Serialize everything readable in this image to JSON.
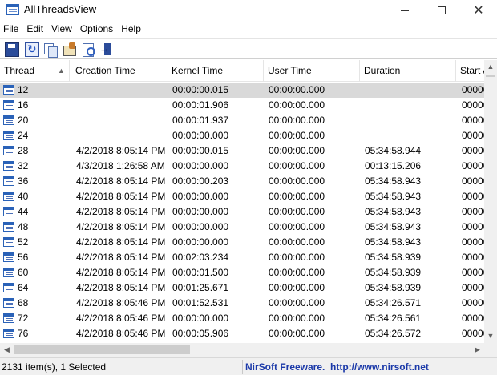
{
  "window": {
    "title": "AllThreadsView",
    "minimize_glyph": "",
    "maximize_glyph": "",
    "close_glyph": "✕"
  },
  "menu": [
    "File",
    "Edit",
    "View",
    "Options",
    "Help"
  ],
  "toolbar": {
    "buttons": [
      "save-icon",
      "refresh-icon",
      "copy-icon",
      "properties-icon",
      "find-icon",
      "exit-icon"
    ]
  },
  "table": {
    "columns": [
      "Thread",
      "Creation Time",
      "Kernel Time",
      "User Time",
      "Duration",
      "Start A"
    ],
    "sort_indicator": "▲",
    "rows": [
      {
        "thread": "12",
        "creation": "",
        "kernel": "00:00:00.015",
        "user": "00:00:00.000",
        "duration": "",
        "start": "00000",
        "selected": true
      },
      {
        "thread": "16",
        "creation": "",
        "kernel": "00:00:01.906",
        "user": "00:00:00.000",
        "duration": "",
        "start": "00000"
      },
      {
        "thread": "20",
        "creation": "",
        "kernel": "00:00:01.937",
        "user": "00:00:00.000",
        "duration": "",
        "start": "00000"
      },
      {
        "thread": "24",
        "creation": "",
        "kernel": "00:00:00.000",
        "user": "00:00:00.000",
        "duration": "",
        "start": "00000"
      },
      {
        "thread": "28",
        "creation": "4/2/2018 8:05:14 PM",
        "kernel": "00:00:00.015",
        "user": "00:00:00.000",
        "duration": "05:34:58.944",
        "start": "00000"
      },
      {
        "thread": "32",
        "creation": "4/3/2018 1:26:58 AM",
        "kernel": "00:00:00.000",
        "user": "00:00:00.000",
        "duration": "00:13:15.206",
        "start": "00000"
      },
      {
        "thread": "36",
        "creation": "4/2/2018 8:05:14 PM",
        "kernel": "00:00:00.203",
        "user": "00:00:00.000",
        "duration": "05:34:58.943",
        "start": "00000"
      },
      {
        "thread": "40",
        "creation": "4/2/2018 8:05:14 PM",
        "kernel": "00:00:00.000",
        "user": "00:00:00.000",
        "duration": "05:34:58.943",
        "start": "00000"
      },
      {
        "thread": "44",
        "creation": "4/2/2018 8:05:14 PM",
        "kernel": "00:00:00.000",
        "user": "00:00:00.000",
        "duration": "05:34:58.943",
        "start": "00000"
      },
      {
        "thread": "48",
        "creation": "4/2/2018 8:05:14 PM",
        "kernel": "00:00:00.000",
        "user": "00:00:00.000",
        "duration": "05:34:58.943",
        "start": "00000"
      },
      {
        "thread": "52",
        "creation": "4/2/2018 8:05:14 PM",
        "kernel": "00:00:00.000",
        "user": "00:00:00.000",
        "duration": "05:34:58.943",
        "start": "00000"
      },
      {
        "thread": "56",
        "creation": "4/2/2018 8:05:14 PM",
        "kernel": "00:02:03.234",
        "user": "00:00:00.000",
        "duration": "05:34:58.939",
        "start": "00000"
      },
      {
        "thread": "60",
        "creation": "4/2/2018 8:05:14 PM",
        "kernel": "00:00:01.500",
        "user": "00:00:00.000",
        "duration": "05:34:58.939",
        "start": "00000"
      },
      {
        "thread": "64",
        "creation": "4/2/2018 8:05:14 PM",
        "kernel": "00:01:25.671",
        "user": "00:00:00.000",
        "duration": "05:34:58.939",
        "start": "00000"
      },
      {
        "thread": "68",
        "creation": "4/2/2018 8:05:46 PM",
        "kernel": "00:01:52.531",
        "user": "00:00:00.000",
        "duration": "05:34:26.571",
        "start": "00000"
      },
      {
        "thread": "72",
        "creation": "4/2/2018 8:05:46 PM",
        "kernel": "00:00:00.000",
        "user": "00:00:00.000",
        "duration": "05:34:26.561",
        "start": "00000"
      },
      {
        "thread": "76",
        "creation": "4/2/2018 8:05:46 PM",
        "kernel": "00:00:05.906",
        "user": "00:00:00.000",
        "duration": "05:34:26.572",
        "start": "00000"
      }
    ]
  },
  "scrollbars": {
    "up": "▲",
    "down": "▼",
    "left": "◀",
    "right": "▶"
  },
  "status": {
    "count": "2131 item(s), 1 Selected",
    "credit": "NirSoft Freeware.  http://www.nirsoft.net"
  }
}
